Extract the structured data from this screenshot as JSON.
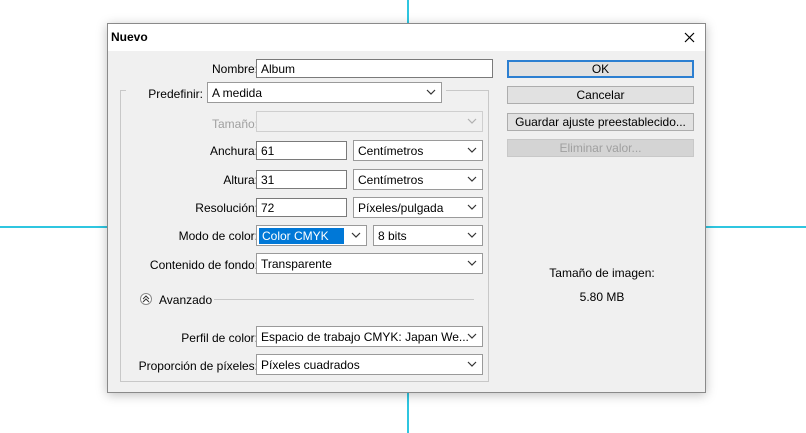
{
  "dialog": {
    "title": "Nuevo",
    "close_icon": "close-icon"
  },
  "form": {
    "nombre_label": "Nombre:",
    "nombre_value": "Album",
    "predefinir_label": "Predefinir:",
    "predefinir_value": "A medida",
    "tamano_label": "Tamaño:",
    "tamano_value": "",
    "anchura_label": "Anchura:",
    "anchura_value": "61",
    "anchura_unit": "Centímetros",
    "altura_label": "Altura:",
    "altura_value": "31",
    "altura_unit": "Centímetros",
    "resolucion_label": "Resolución:",
    "resolucion_value": "72",
    "resolucion_unit": "Píxeles/pulgada",
    "modo_label": "Modo de color:",
    "modo_value": "Color CMYK",
    "bits_value": "8 bits",
    "fondo_label": "Contenido de fondo:",
    "fondo_value": "Transparente",
    "avanzado_label": "Avanzado",
    "perfil_label": "Perfil de color:",
    "perfil_value": "Espacio de trabajo CMYK: Japan We...",
    "proporcion_label": "Proporción de píxeles:",
    "proporcion_value": "Píxeles cuadrados"
  },
  "buttons": {
    "ok": "OK",
    "cancel": "Cancelar",
    "save_preset": "Guardar ajuste preestablecido...",
    "delete_preset": "Eliminar valor..."
  },
  "image_size": {
    "label": "Tamaño de imagen:",
    "value": "5.80 MB"
  },
  "colors": {
    "guide": "#2fc6e0",
    "selection": "#0078d7",
    "default_button_border": "#2c7fd1"
  }
}
